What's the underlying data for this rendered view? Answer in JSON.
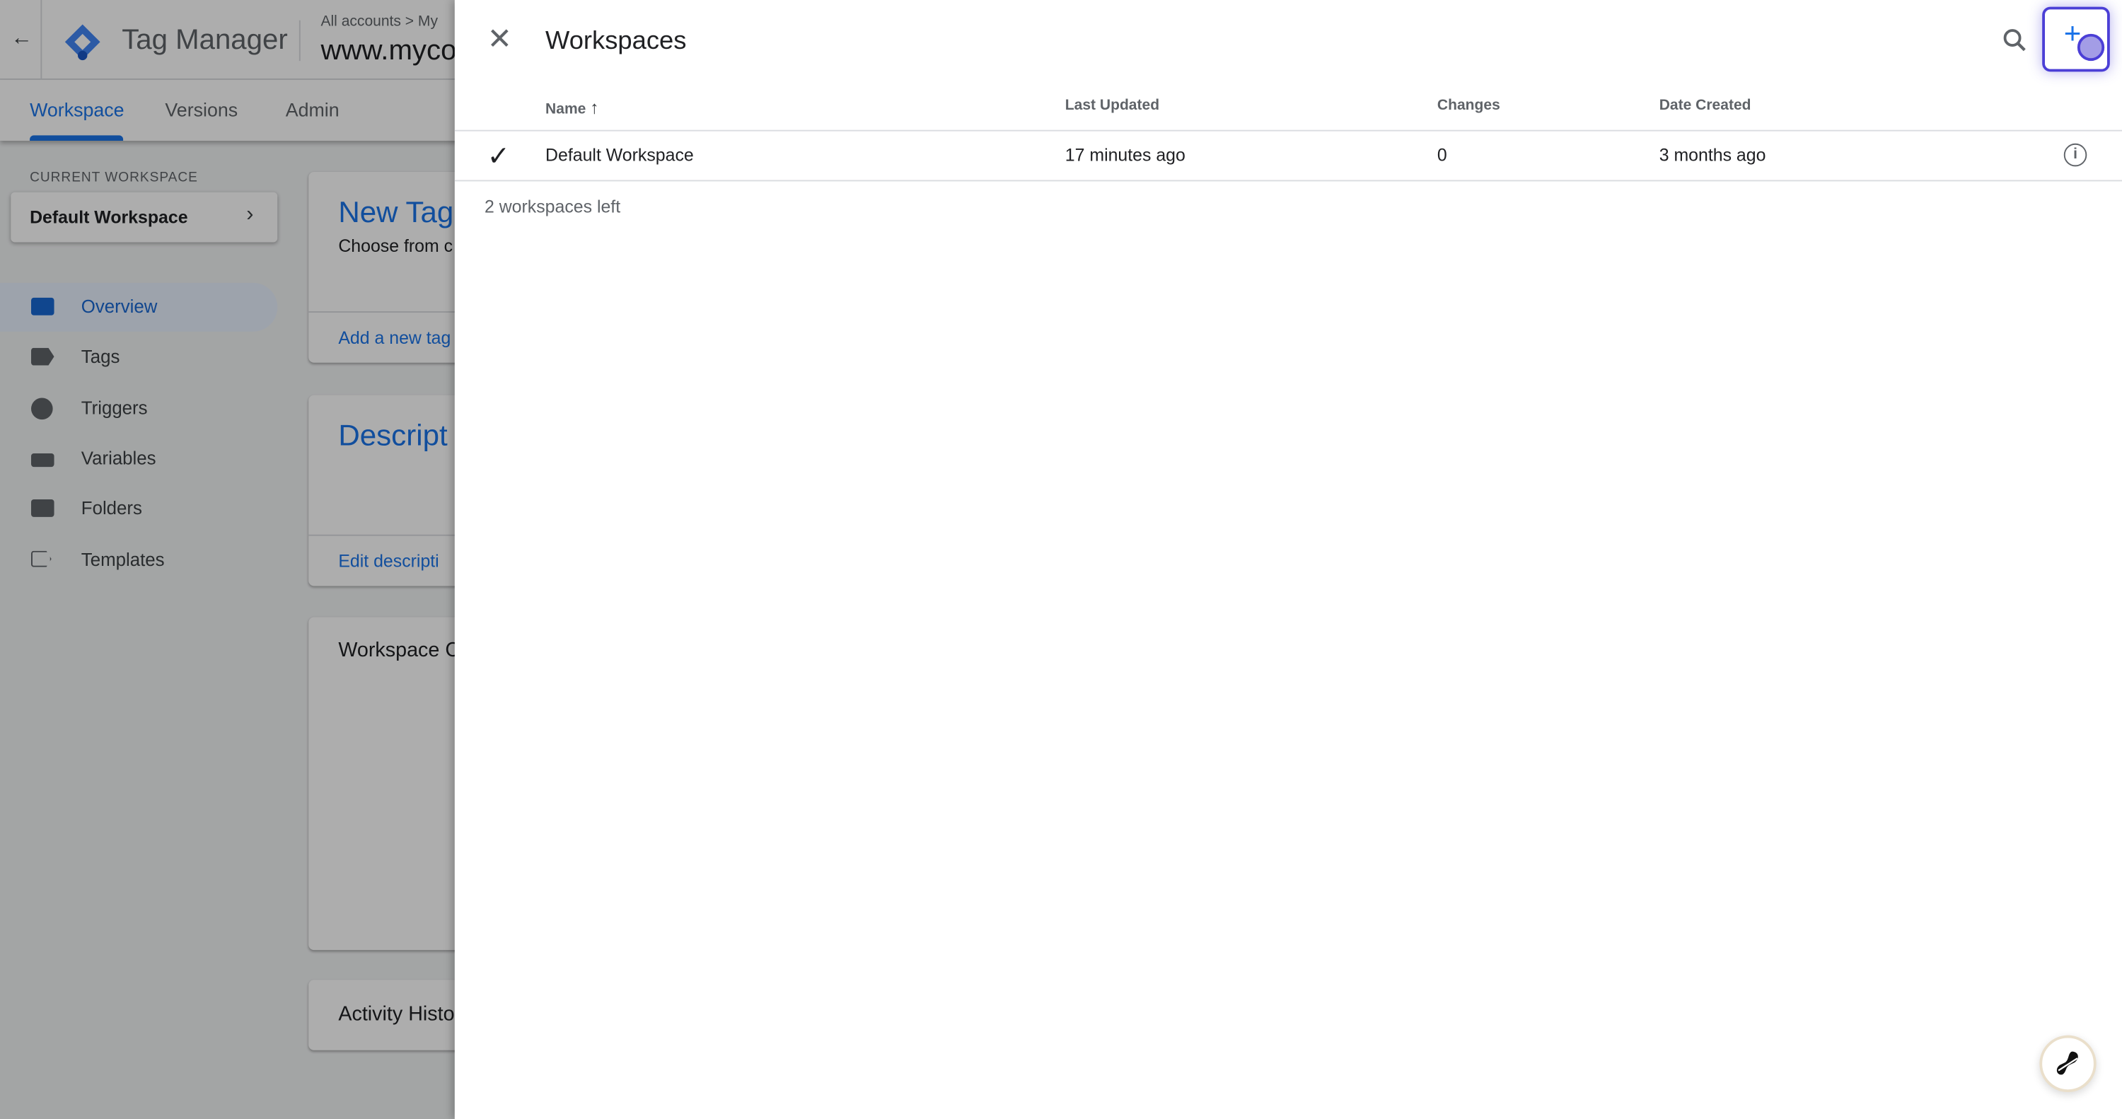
{
  "header": {
    "app_title": "Tag Manager",
    "breadcrumb": "All accounts > My",
    "container_name": "www.myco"
  },
  "tabs": [
    {
      "label": "Workspace",
      "active": true
    },
    {
      "label": "Versions",
      "active": false
    },
    {
      "label": "Admin",
      "active": false
    }
  ],
  "sidebar": {
    "current_workspace_label": "CURRENT WORKSPACE",
    "current_workspace": "Default Workspace",
    "items": [
      {
        "label": "Overview",
        "icon": "overview-icon",
        "active": true
      },
      {
        "label": "Tags",
        "icon": "tag-icon"
      },
      {
        "label": "Triggers",
        "icon": "trigger-icon"
      },
      {
        "label": "Variables",
        "icon": "variables-icon"
      },
      {
        "label": "Folders",
        "icon": "folder-icon"
      },
      {
        "label": "Templates",
        "icon": "template-icon"
      }
    ]
  },
  "cards": {
    "new_tag_title": "New Tag",
    "new_tag_desc": "Choose from c",
    "new_tag_link": "Add a new tag",
    "description_title": "Descript",
    "description_link": "Edit descripti",
    "workspace_changes_title": "Workspace C",
    "activity_title": "Activity Histo"
  },
  "panel": {
    "title": "Workspaces",
    "columns": [
      "Name",
      "Last Updated",
      "Changes",
      "Date Created"
    ],
    "sort_indicator": "arrow-up-icon",
    "rows": [
      {
        "name": "Default Workspace",
        "last_updated": "17 minutes ago",
        "changes": "0",
        "date_created": "3 months ago",
        "selected": true
      }
    ],
    "footer": "2 workspaces left"
  },
  "colors": {
    "accent": "#1a73e8",
    "highlight": "#4b3fd6"
  }
}
